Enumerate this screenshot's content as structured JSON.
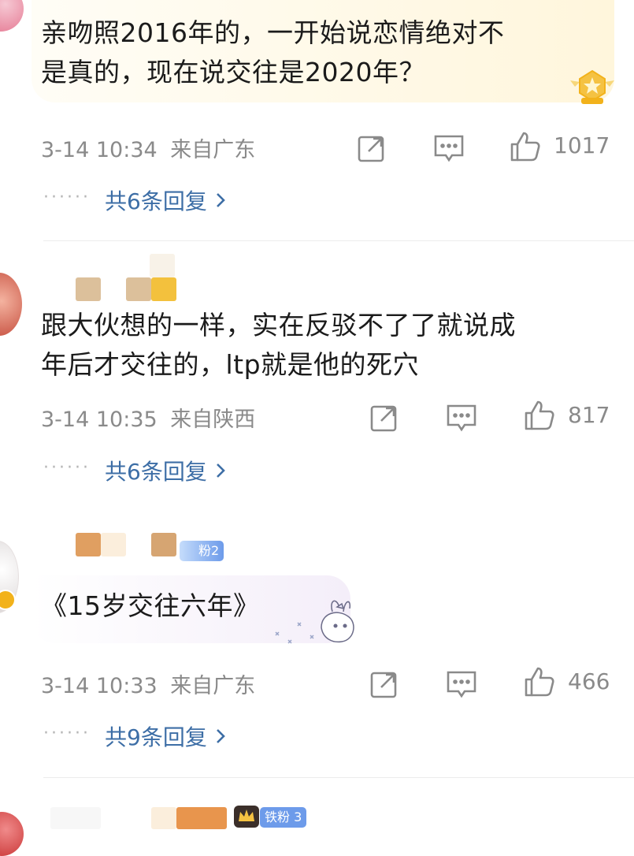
{
  "comments": [
    {
      "text": "亲吻照2016年的，一开始说恋情绝对不是真的，现在说交往是2020年？",
      "line1": "亲吻照2016年的，一开始说恋情绝对不",
      "line2": "是真的，现在说交往是2020年？",
      "time": "3-14 10:34",
      "location": "来自广东",
      "likes": "1017",
      "replies": "共6条回复"
    },
    {
      "text": "跟大伙想的一样，实在反驳不了了就说成年后才交往的，ltp就是他的死穴",
      "line1": "跟大伙想的一样，实在反驳不了了就说成",
      "line2": "年后才交往的，ltp就是他的死穴",
      "time": "3-14 10:35",
      "location": "来自陕西",
      "likes": "817",
      "replies": "共6条回复"
    },
    {
      "text": "《15岁交往六年》",
      "time": "3-14 10:33",
      "location": "来自广东",
      "likes": "466",
      "replies": "共9条回复",
      "badge": "粉2"
    },
    {
      "badge": "铁粉 3"
    }
  ],
  "icons": {
    "share": "share-icon",
    "comment": "comment-icon",
    "like": "like-icon",
    "chevron": "chevron-right-icon"
  },
  "colors": {
    "link": "#3d6ea6",
    "meta": "#8a8a8a",
    "badge": "#6d9bea"
  }
}
